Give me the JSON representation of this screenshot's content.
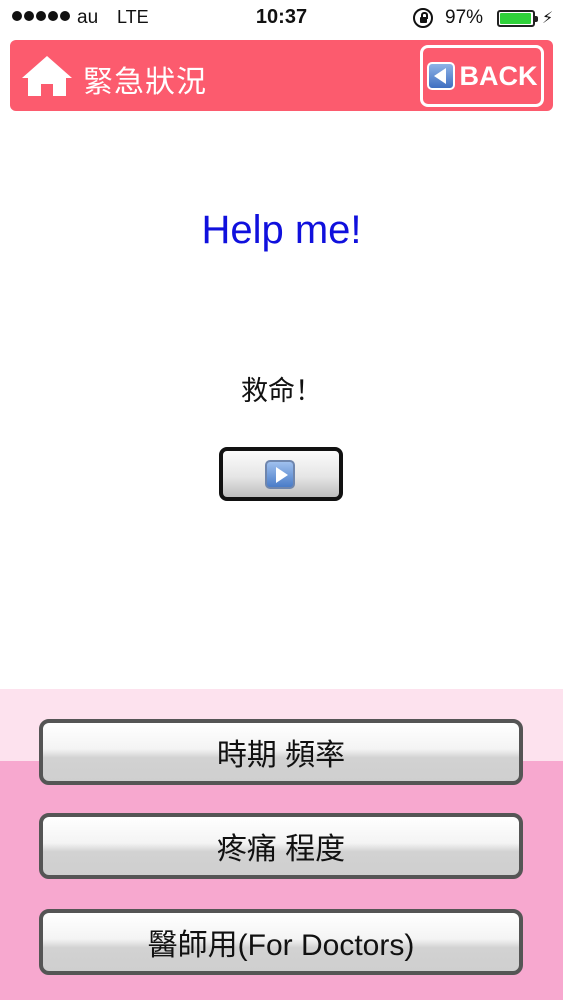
{
  "status_bar": {
    "carrier": "au",
    "network": "LTE",
    "time": "10:37",
    "battery": "97%",
    "battery_level": 0.97
  },
  "header": {
    "title": "緊急狀況",
    "back_label": "BACK"
  },
  "content": {
    "phrase_en": "Help me!",
    "phrase_local": "救命！"
  },
  "menu": {
    "items": [
      {
        "label": "時期 頻率"
      },
      {
        "label": "疼痛 程度"
      },
      {
        "label": "醫師用(For Doctors)"
      }
    ]
  },
  "colors": {
    "header": "#fc5b6e",
    "phrase_en": "#1010dd",
    "panel_light": "#fde2ee",
    "panel_pink": "#f7a8cf",
    "battery": "#2fd13a"
  },
  "icons": [
    "signal-dots-icon",
    "rotation-lock-icon",
    "battery-icon",
    "charging-icon",
    "home-icon",
    "back-arrow-icon",
    "play-icon"
  ]
}
